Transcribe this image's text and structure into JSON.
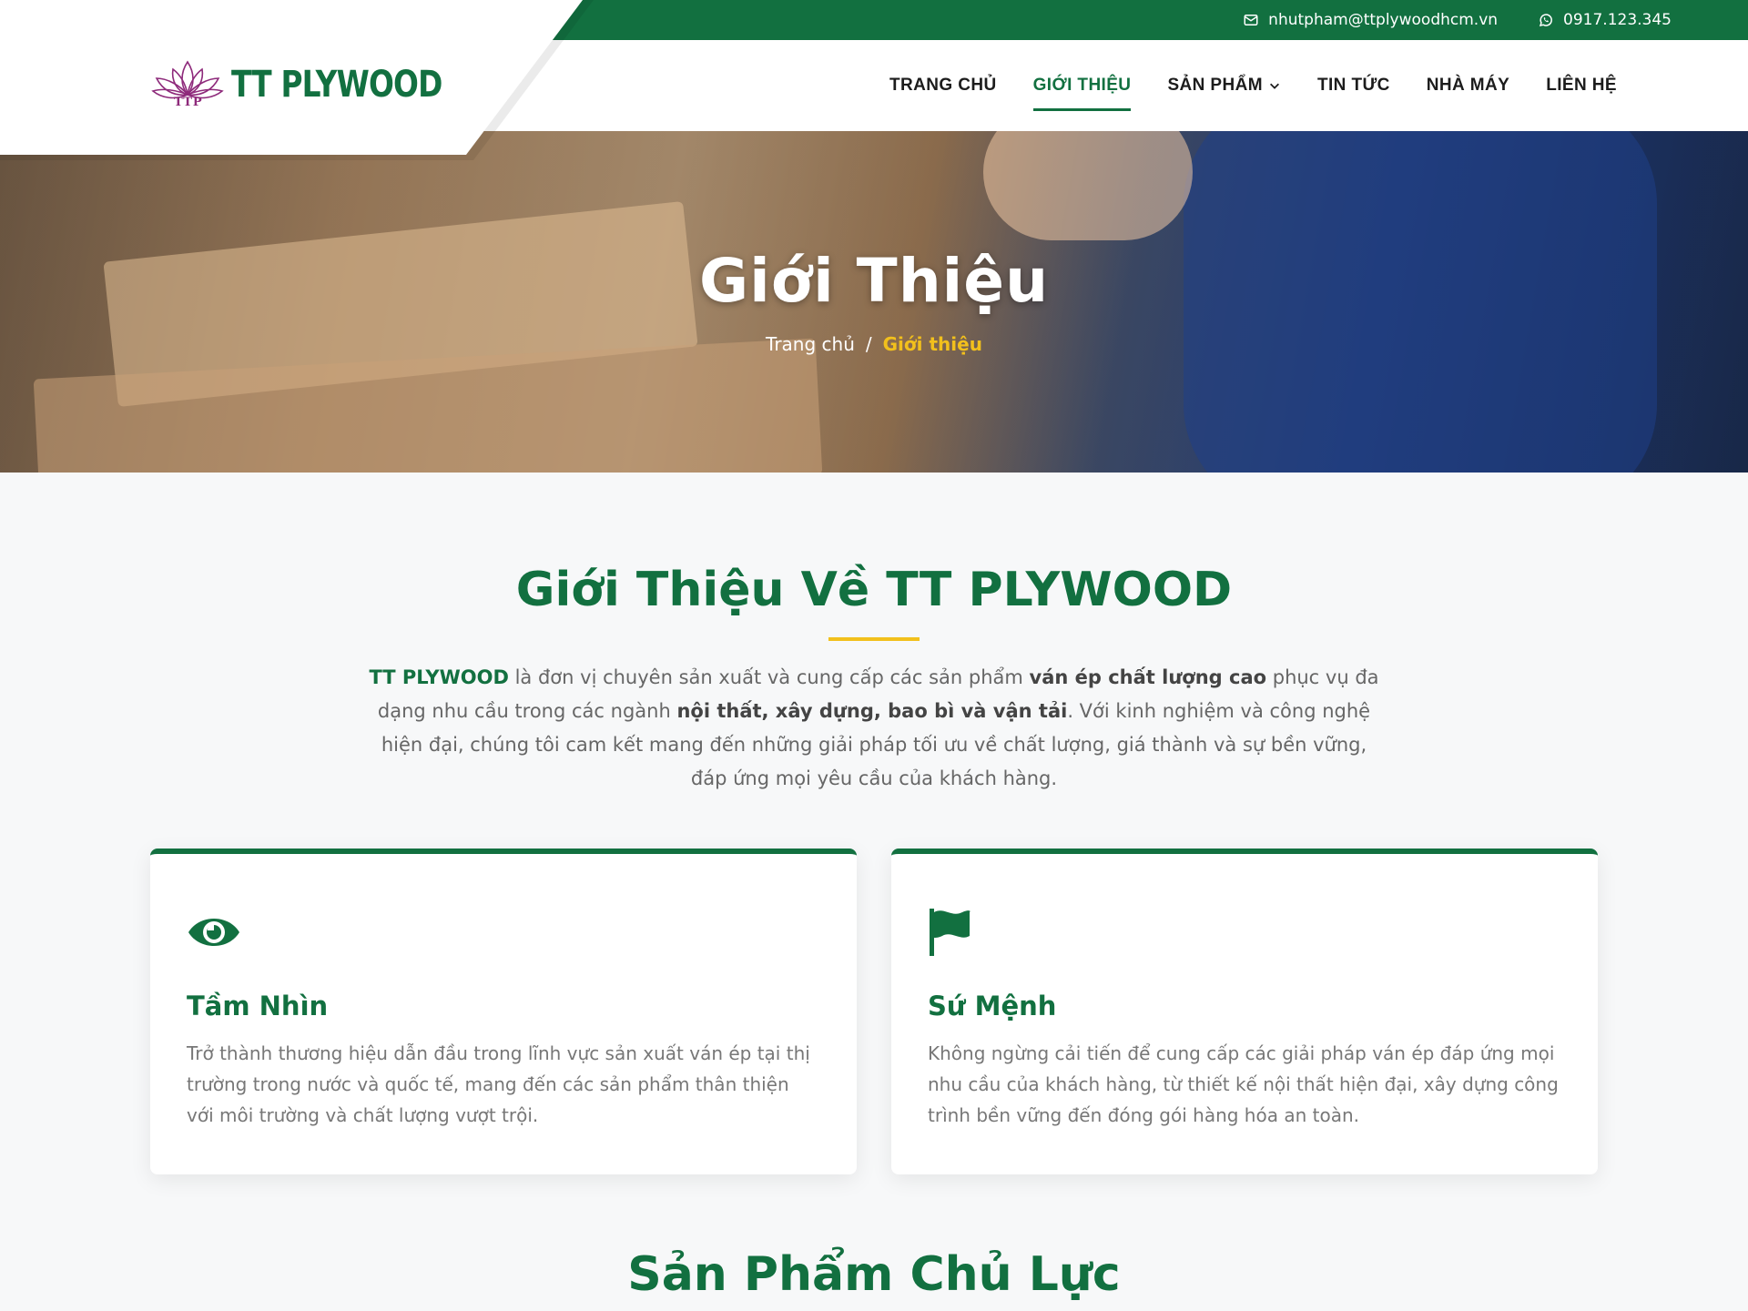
{
  "topbar": {
    "email": "nhutpham@ttplywoodhcm.vn",
    "phone": "0917.123.345",
    "email_icon": "envelope-icon",
    "phone_icon": "whatsapp-icon"
  },
  "brand": {
    "logo_text": "TT PLYWOOD",
    "logo_mark_text": "TTP",
    "logo_icon": "lotus-icon"
  },
  "nav": {
    "items": [
      {
        "label": "TRANG CHỦ"
      },
      {
        "label": "GIỚI THIỆU",
        "active": true
      },
      {
        "label": "SẢN PHẨM",
        "dropdown": true
      },
      {
        "label": "TIN TỨC"
      },
      {
        "label": "NHÀ MÁY"
      },
      {
        "label": "LIÊN HỆ"
      }
    ]
  },
  "hero": {
    "title": "Giới Thiệu",
    "breadcrumb_home": "Trang chủ",
    "breadcrumb_sep": "/",
    "breadcrumb_current": "Giới thiệu"
  },
  "about": {
    "title": "Giới Thiệu Về TT PLYWOOD",
    "p_brand": "TT PLYWOOD",
    "p1": " là đơn vị chuyên sản xuất và cung cấp các sản phẩm ",
    "p_b1": "ván ép chất lượng cao",
    "p2": " phục vụ đa dạng nhu cầu trong các ngành ",
    "p_b2": "nội thất, xây dựng, bao bì và vận tải",
    "p3": ". Với kinh nghiệm và công nghệ hiện đại, chúng tôi cam kết mang đến những giải pháp tối ưu về chất lượng, giá thành và sự bền vững, đáp ứng mọi yêu cầu của khách hàng."
  },
  "cards": [
    {
      "icon": "eye-icon",
      "title": "Tầm Nhìn",
      "text": "Trở thành thương hiệu dẫn đầu trong lĩnh vực sản xuất ván ép tại thị trường trong nước và quốc tế, mang đến các sản phẩm thân thiện với môi trường và chất lượng vượt trội."
    },
    {
      "icon": "flag-icon",
      "title": "Sứ Mệnh",
      "text": "Không ngừng cải tiến để cung cấp các giải pháp ván ép đáp ứng mọi nhu cầu của khách hàng, từ thiết kế nội thất hiện đại, xây dựng công trình bền vững đến đóng gói hàng hóa an toàn."
    }
  ],
  "products": {
    "title": "Sản Phẩm Chủ Lực"
  },
  "colors": {
    "brand_green": "#127040",
    "accent_yellow": "#f2c01c",
    "logo_purple": "#8e2a7b"
  }
}
